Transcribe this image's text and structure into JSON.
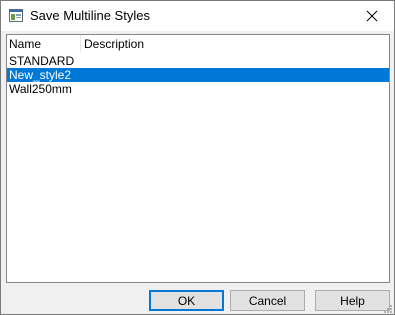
{
  "window": {
    "title": "Save Multiline Styles",
    "icon": "multiline-app-icon",
    "close_icon": "close-icon"
  },
  "list": {
    "columns": [
      "Name",
      "Description"
    ],
    "rows": [
      {
        "name": "STANDARD",
        "description": "",
        "selected": false
      },
      {
        "name": "New_style2",
        "description": "",
        "selected": true
      },
      {
        "name": "Wall250mm",
        "description": "",
        "selected": false
      }
    ]
  },
  "buttons": {
    "ok": "OK",
    "cancel": "Cancel",
    "help": "Help"
  },
  "colors": {
    "selection": "#0078d7",
    "dialog_bg": "#f0f0f0"
  }
}
